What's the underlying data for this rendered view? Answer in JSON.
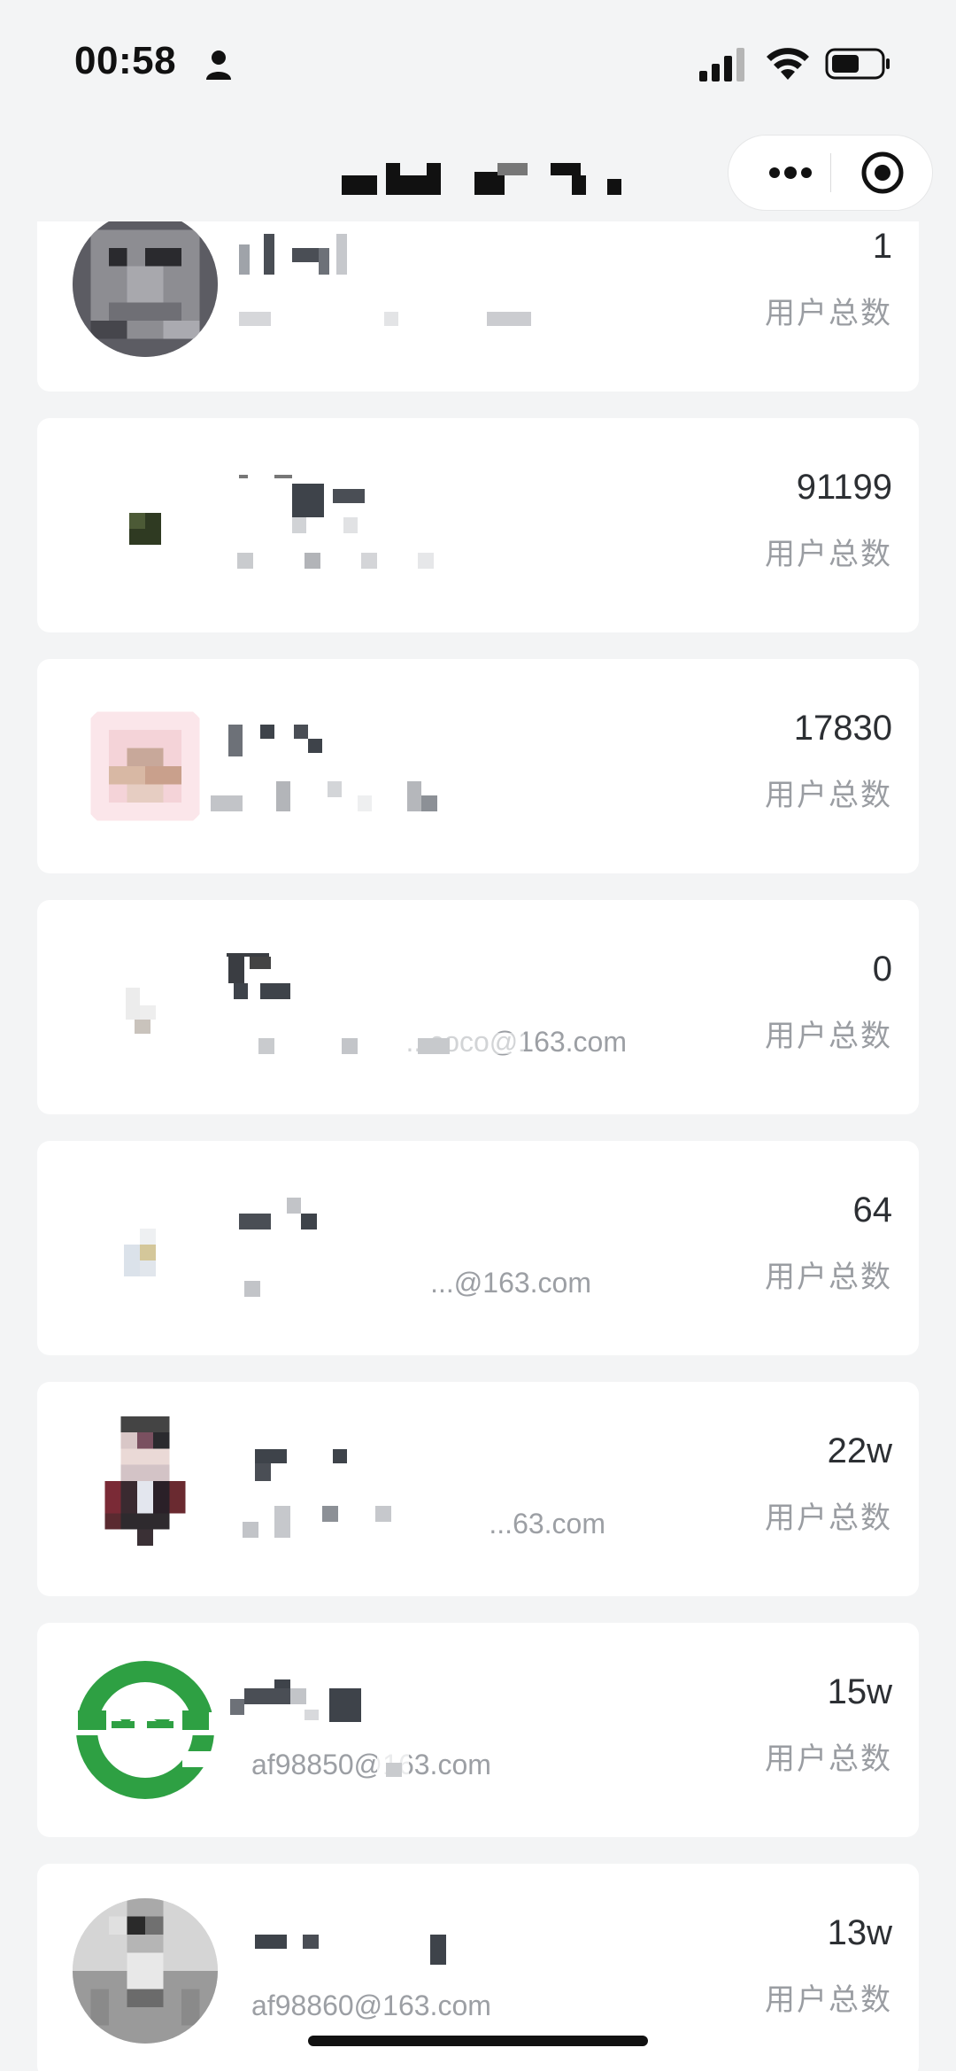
{
  "status_bar": {
    "time": "00:58"
  },
  "nav": {
    "title": "",
    "capsule": {
      "more_icon": "more-dots-icon",
      "close_icon": "target-circle-icon"
    }
  },
  "list": {
    "items": [
      {
        "name": "",
        "email": "",
        "count": "1",
        "count_label": "用户总数",
        "avatar": "gray-mosaic"
      },
      {
        "name": "",
        "email": "",
        "count": "91199",
        "count_label": "用户总数",
        "avatar": "small-dark-square"
      },
      {
        "name": "",
        "email": "",
        "count": "17830",
        "count_label": "用户总数",
        "avatar": "pink-flower-mosaic"
      },
      {
        "name": "",
        "email": "...coco@163.com",
        "count": "0",
        "count_label": "用户总数",
        "avatar": "faint-mosaic"
      },
      {
        "name": "",
        "email": "...@163.com",
        "count": "64",
        "count_label": "用户总数",
        "avatar": "tiny-mosaic"
      },
      {
        "name": "",
        "email": "...63.com",
        "count": "22w",
        "count_label": "用户总数",
        "avatar": "person-mosaic"
      },
      {
        "name": "",
        "email": "af98850@163.com",
        "count": "15w",
        "count_label": "用户总数",
        "avatar": "green-mascot"
      },
      {
        "name": "",
        "email": "af98860@163.com",
        "count": "13w",
        "count_label": "用户总数",
        "avatar": "bird-mosaic"
      }
    ]
  },
  "colors": {
    "background": "#f3f4f5",
    "card": "#ffffff",
    "count_text": "#2c2f33",
    "label_text": "#9a9da2",
    "mascot_green": "#2ea043"
  }
}
